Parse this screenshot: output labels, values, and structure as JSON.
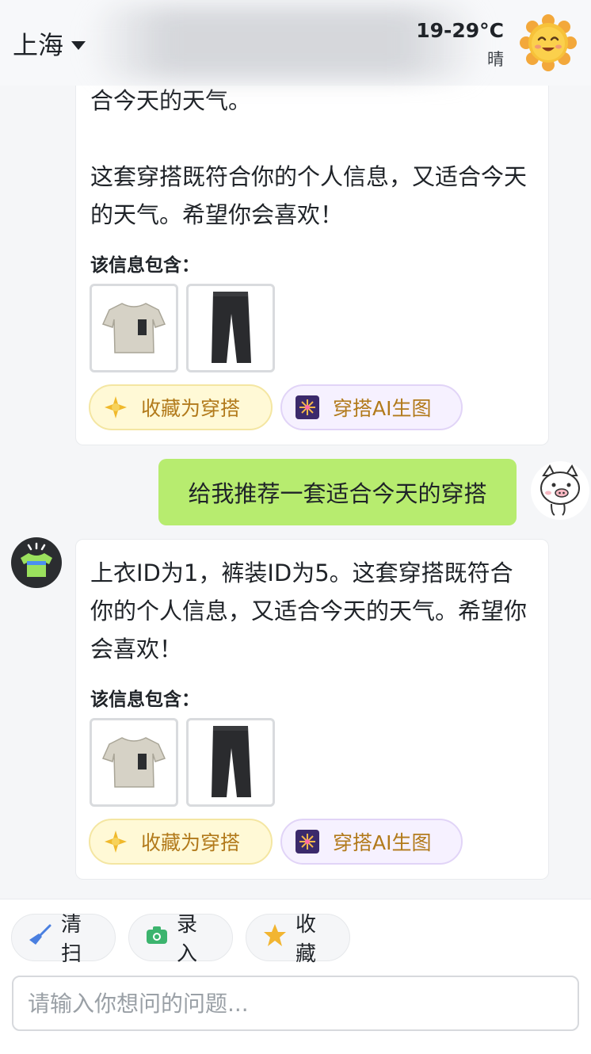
{
  "header": {
    "city": "上海",
    "temperature": "19-29°C",
    "condition": "晴"
  },
  "messages": {
    "bot1": {
      "text_partial": "合今天的天气。",
      "text": "这套穿搭既符合你的个人信息，又适合今天的天气。希望你会喜欢！",
      "info_label": "该信息包含：",
      "chip_favorite": "收藏为穿搭",
      "chip_ai": "穿搭AI生图"
    },
    "user1": {
      "text": "给我推荐一套适合今天的穿搭"
    },
    "bot2": {
      "text": "上衣ID为1，裤装ID为5。这套穿搭既符合你的个人信息，又适合今天的天气。希望你会喜欢！",
      "info_label": "该信息包含：",
      "chip_favorite": "收藏为穿搭",
      "chip_ai": "穿搭AI生图"
    }
  },
  "toolbar": {
    "clean_label": "清扫",
    "record_label": "录入",
    "favorites_label": "收藏"
  },
  "input": {
    "placeholder": "请输入你想问的问题..."
  },
  "colors": {
    "user_bubble": "#b7ec6f",
    "chip_text": "#b27a1b"
  }
}
